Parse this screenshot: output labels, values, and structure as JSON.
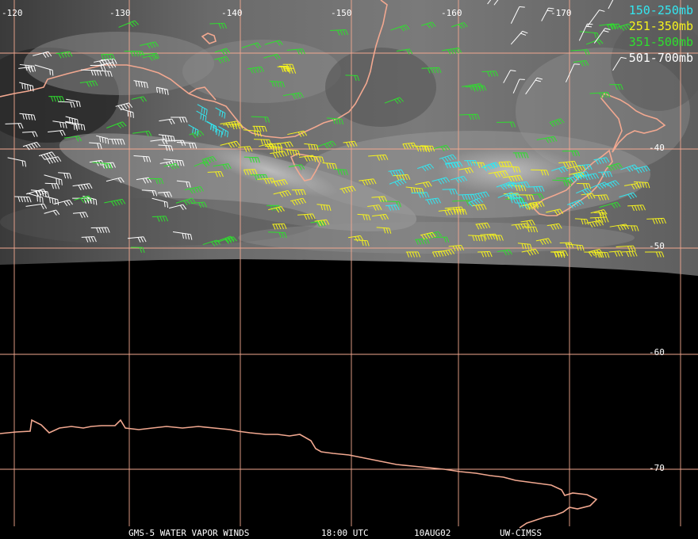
{
  "image": {
    "footer": {
      "satellite": "GMS-5 WATER VAPOR WINDS",
      "time": "18:00 UTC",
      "date": "10AUG02",
      "credit": "UW-CIMSS"
    },
    "legend": [
      {
        "label": "150-250mb",
        "color": "#33e6f0"
      },
      {
        "label": "251-350mb",
        "color": "#f5f21e"
      },
      {
        "label": "351-500mb",
        "color": "#2ee02e"
      },
      {
        "label": "501-700mb",
        "color": "#ffffff"
      }
    ],
    "lon_labels": [
      "-120",
      "-130",
      "-140",
      "-150",
      "-160",
      "-170"
    ],
    "lat_labels": [
      "-40",
      "-50",
      "-60",
      "-70"
    ],
    "colors": {
      "grid": "#f2a890",
      "coast": "#f2a890",
      "background": "#000000"
    }
  }
}
